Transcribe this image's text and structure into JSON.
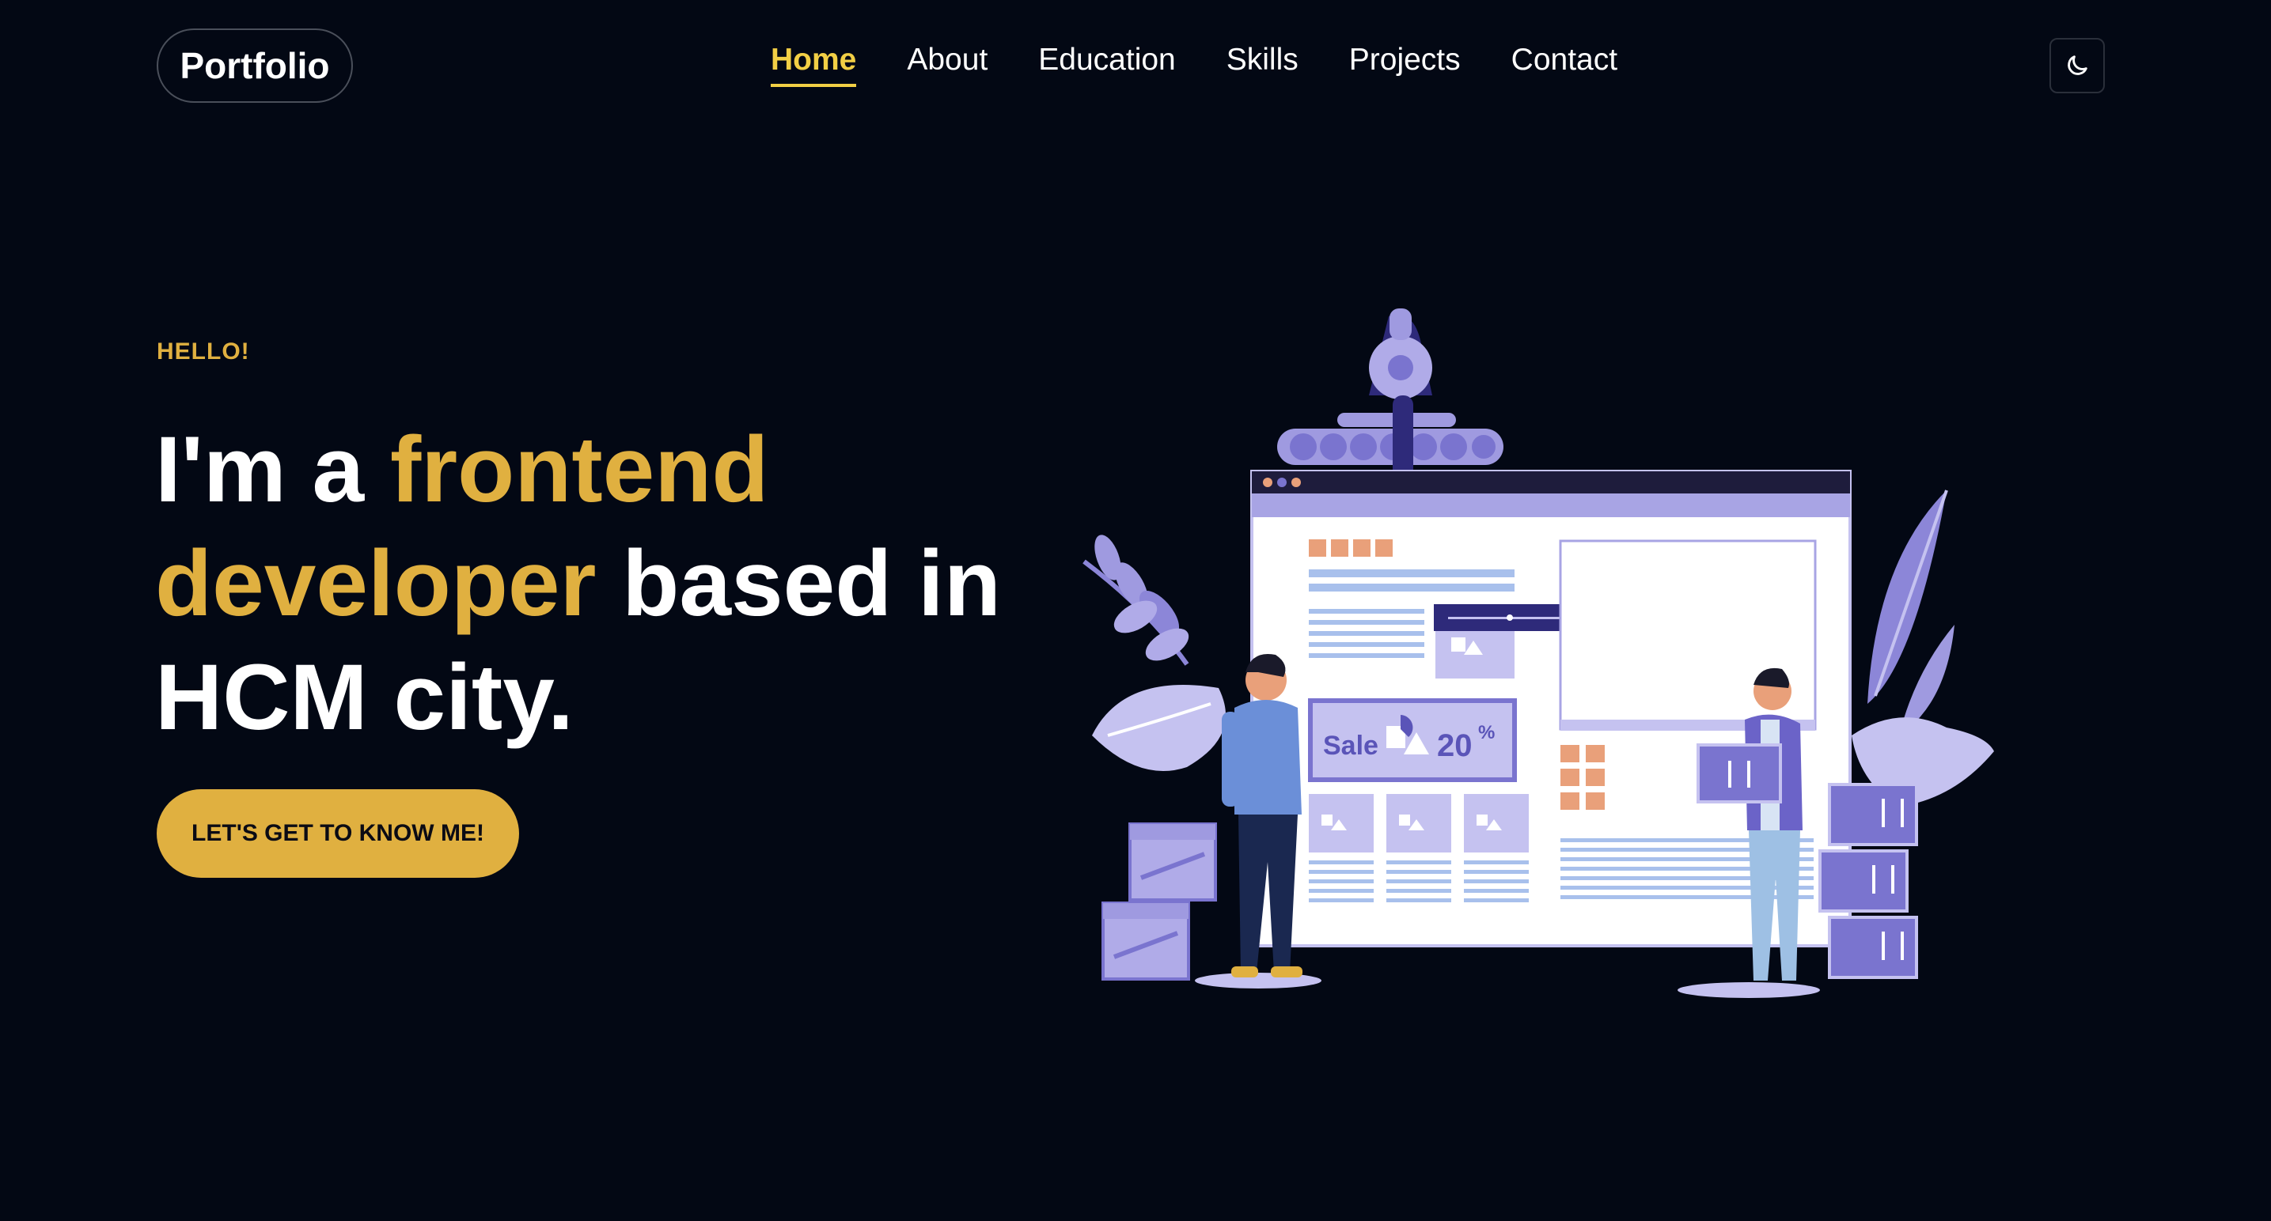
{
  "header": {
    "logo": "Portfolio",
    "nav": [
      {
        "label": "Home",
        "active": true
      },
      {
        "label": "About",
        "active": false
      },
      {
        "label": "Education",
        "active": false
      },
      {
        "label": "Skills",
        "active": false
      },
      {
        "label": "Projects",
        "active": false
      },
      {
        "label": "Contact",
        "active": false
      }
    ],
    "theme_toggle_icon": "moon-icon"
  },
  "hero": {
    "eyebrow": "HELLO!",
    "headline_part1": "I'm a ",
    "headline_accent": "frontend developer",
    "headline_part2": " based in HCM city.",
    "cta_label": "LET'S GET TO KNOW ME!",
    "illustration": {
      "sale_label": "Sale",
      "sale_percent": "20",
      "percent_sign": "%"
    }
  },
  "colors": {
    "background": "#030814",
    "accent": "#e0b040",
    "nav_active": "#f2cf45",
    "illustration_primary": "#7a74cf",
    "illustration_light": "#c5c2f0"
  }
}
